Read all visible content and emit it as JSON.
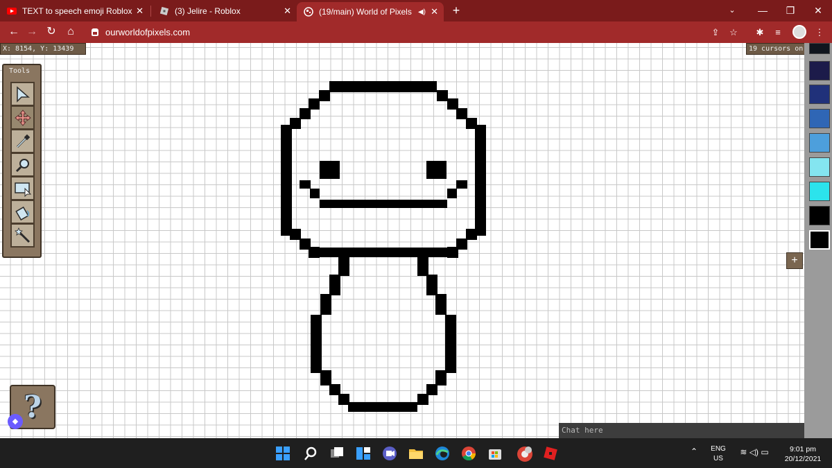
{
  "browser": {
    "tabs": [
      {
        "title": "TEXT to speech emoji Roblox",
        "close": "✕"
      },
      {
        "title": "(3) Jelire - Roblox",
        "close": "✕"
      },
      {
        "title": "(19/main) World of Pixels",
        "close": "✕"
      }
    ],
    "new_tab": "+",
    "address": "ourworldofpixels.com",
    "window_controls": {
      "minimize": "—",
      "restore": "❐",
      "close": "✕"
    }
  },
  "game": {
    "coordinates": "X: 8154, Y: 13439",
    "cursors": "19 cursors on",
    "tools_title": "Tools",
    "tools": [
      "cursor-tool",
      "move-tool",
      "pipette-tool",
      "zoom-tool",
      "area-export-tool",
      "fill-tool",
      "wand-tool"
    ],
    "help": "?",
    "add_color": "+",
    "chat_placeholder": "Chat here",
    "palette": [
      "#10151e",
      "#1c1b4a",
      "#20317a",
      "#2f66b5",
      "#4d9fdc",
      "#84e5f0",
      "#2ce3ec",
      "#000000"
    ],
    "selected_color": "#000000"
  },
  "taskbar": {
    "language": "ENG",
    "region": "US",
    "time": "9:01 pm",
    "date": "20/12/2021"
  }
}
